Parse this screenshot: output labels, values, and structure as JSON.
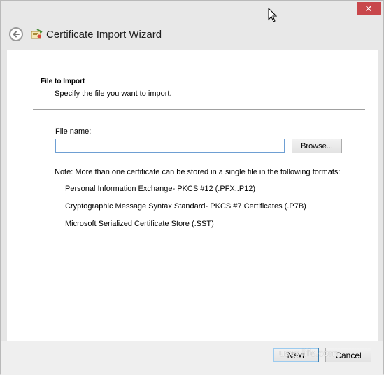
{
  "window": {
    "title": "Certificate Import Wizard",
    "close_symbol": "✕"
  },
  "page": {
    "section_title": "File to Import",
    "section_desc": "Specify the file you want to import.",
    "file_label": "File name:",
    "file_value": "",
    "browse_label": "Browse...",
    "note": "Note:  More than one certificate can be stored in a single file in the following formats:",
    "formats": [
      "Personal Information Exchange- PKCS #12 (.PFX,.P12)",
      "Cryptographic Message Syntax Standard- PKCS #7 Certificates (.P7B)",
      "Microsoft Serialized Certificate Store (.SST)"
    ]
  },
  "footer": {
    "next_label": "Next",
    "cancel_label": "Cancel"
  },
  "watermark": "user-life.com",
  "icons": {
    "back": "back-arrow-icon",
    "wizard": "certificate-icon",
    "close": "close-icon",
    "cursor": "mouse-cursor-icon"
  }
}
